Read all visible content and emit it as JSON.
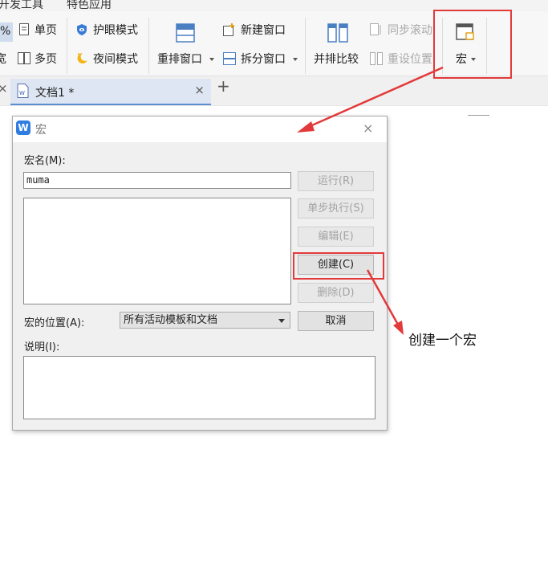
{
  "menu": {
    "items": [
      "开发工具",
      "特色应用"
    ]
  },
  "ribbon": {
    "zoom_fragment": "%",
    "single_page": "单页",
    "multi_page": "多页",
    "side_fragment": "宽",
    "eye_mode": "护眼模式",
    "night_mode": "夜间模式",
    "rearrange_window": "重排窗口",
    "new_window": "新建窗口",
    "split_window": "拆分窗口",
    "side_by_side": "并排比较",
    "sync_scroll": "同步滚动",
    "reset_position": "重设位置",
    "macro": "宏"
  },
  "tabs": {
    "doc_title": "文档1 *",
    "close": "×",
    "add": "+"
  },
  "dialog": {
    "title": "宏",
    "close": "×",
    "macro_name_label": "宏名(M):",
    "macro_name_value": "muma",
    "buttons": {
      "run": "运行(R)",
      "step": "单步执行(S)",
      "edit": "编辑(E)",
      "create": "创建(C)",
      "delete": "删除(D)",
      "cancel": "取消"
    },
    "location_label": "宏的位置(A):",
    "location_value": "所有活动模板和文档",
    "description_label": "说明(I):"
  },
  "annotation": {
    "note": "创建一个宏",
    "color": "#e23a3a"
  }
}
